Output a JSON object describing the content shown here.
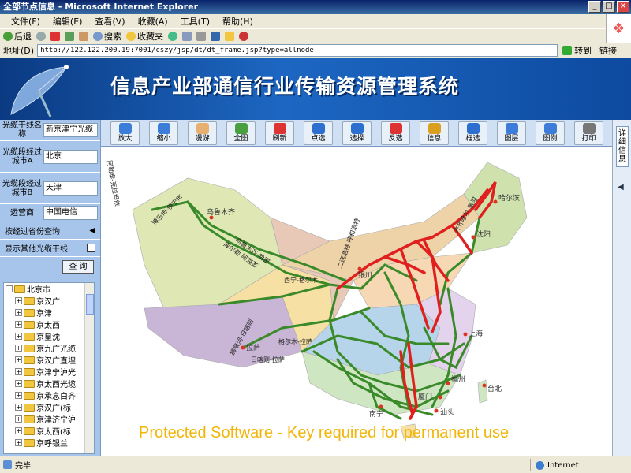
{
  "window": {
    "title": "全部节点信息 - Microsoft Internet Explorer",
    "minimize": "_",
    "maximize": "□",
    "close": "×"
  },
  "menu": [
    "文件(F)",
    "编辑(E)",
    "查看(V)",
    "收藏(A)",
    "工具(T)",
    "帮助(H)"
  ],
  "toolbar": {
    "back": "后退",
    "search": "搜索",
    "favorites": "收藏夹"
  },
  "address": {
    "label": "地址(D)",
    "url": "http://122.122.200.19:7001/cszy/jsp/dt/dt_frame.jsp?type=allnode",
    "go": "转到",
    "links": "链接"
  },
  "banner": {
    "title": "信息产业部通信行业传输资源管理系统"
  },
  "form": {
    "fields": [
      {
        "label": "光缆干线名称",
        "value": "新京津宁光缆"
      },
      {
        "label": "光缆段经过城市A",
        "value": "北京"
      },
      {
        "label": "光缆段经过城市B",
        "value": "天津"
      },
      {
        "label": "运营商",
        "value": "中国电信"
      }
    ],
    "province_query": "按经过省份查询",
    "show_others": "显示其他光缆干线:",
    "query_button": "查 询"
  },
  "tree": {
    "root": "北京市",
    "items": [
      "京汉广",
      "京津",
      "京太西",
      "京皇沈",
      "京九广光缆",
      "京汉广直埋",
      "京津宁沪光",
      "京太西光缆",
      "京承息白齐",
      "京汉广(标",
      "京津济宁沪",
      "京太西(标",
      "京呼银兰"
    ]
  },
  "map_tools": [
    "放大",
    "缩小",
    "漫游",
    "全图",
    "刷新",
    "点选",
    "选择",
    "反选",
    "信息",
    "框选",
    "图层",
    "图例",
    "打印"
  ],
  "side_tab": "详细信息",
  "map": {
    "cities": [
      "乌鲁木齐",
      "哈尔滨",
      "沈阳",
      "银川",
      "上海",
      "福州",
      "台北",
      "拉萨",
      "厦门",
      "南宁",
      "汕头"
    ],
    "routes": [
      "博乐市-伊宁市",
      "乌鲁木齐-哈密",
      "库尔勒-阿克苏",
      "西宁-格尔木",
      "格尔木-拉萨",
      "二连浩特-呼和浩特",
      "齐齐哈尔-黑河",
      "狮泉河-日喀则",
      "日喀则-拉萨",
      "阿勒泰-克拉玛依"
    ]
  },
  "watermark": "Protected  Software - Key required for permanent use",
  "status": {
    "text": "完毕",
    "zone": "Internet"
  },
  "colors": {
    "route_green": "#3a8a2a",
    "route_red": "#e0201e",
    "banner_blue": "#1d67c2",
    "panel_blue": "#a7c5ea"
  }
}
